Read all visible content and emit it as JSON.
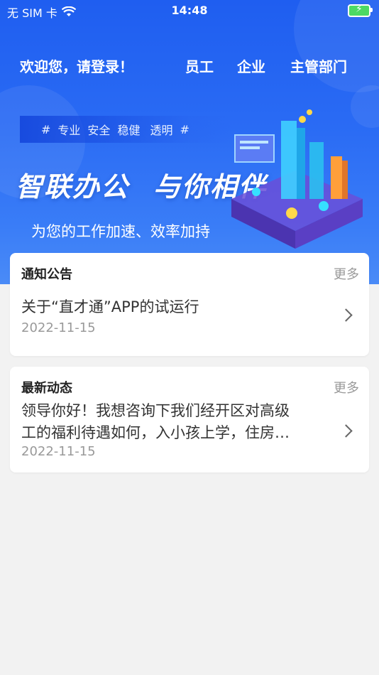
{
  "status": {
    "carrier": "无 SIM 卡",
    "time": "14:48",
    "colors": {
      "battery": "#4cd964"
    }
  },
  "nav": {
    "welcome": "欢迎您，请登录！",
    "items": [
      "员工",
      "企业",
      "主管部门"
    ]
  },
  "banner": {
    "tag_hash": "#",
    "tags": [
      "专业",
      "安全",
      "稳健",
      "透明"
    ],
    "slogan": [
      "智联办公",
      "与你相伴"
    ],
    "subslogan": "为您的工作加速、效率加持"
  },
  "notice": {
    "title": "通知公告",
    "more": "更多",
    "item": {
      "text": "关于“直才通”APP的试运行",
      "date": "2022-11-15"
    }
  },
  "news": {
    "title": "最新动态",
    "more": "更多",
    "item": {
      "line1": "领导你好！我想咨询下我们经开区对高级",
      "line2": "工的福利待遇如何，入小孩上学，住房…",
      "date": "2022-11-15"
    }
  },
  "colors": {
    "primary": "#2a6bf4",
    "page_bg": "#f2f2f2"
  }
}
